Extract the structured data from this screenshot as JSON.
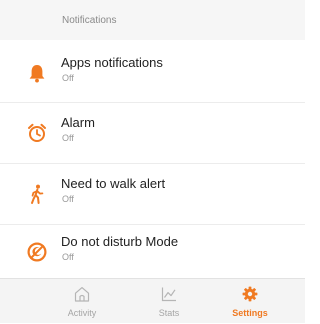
{
  "header": {
    "title": "Notifications"
  },
  "colors": {
    "accent": "#f07a22"
  },
  "settings_list": [
    {
      "label": "Apps notifications",
      "value": "Off",
      "icon": "bell-icon"
    },
    {
      "label": "Alarm",
      "value": "Off",
      "icon": "alarm-clock-icon"
    },
    {
      "label": "Need to walk alert",
      "value": "Off",
      "icon": "walking-person-icon"
    },
    {
      "label": "Do not disturb Mode",
      "value": "Off",
      "icon": "do-not-disturb-icon"
    }
  ],
  "bottom_nav": [
    {
      "label": "Activity",
      "icon": "home-icon",
      "active": false
    },
    {
      "label": "Stats",
      "icon": "chart-icon",
      "active": false
    },
    {
      "label": "Settings",
      "icon": "gear-icon",
      "active": true
    }
  ]
}
